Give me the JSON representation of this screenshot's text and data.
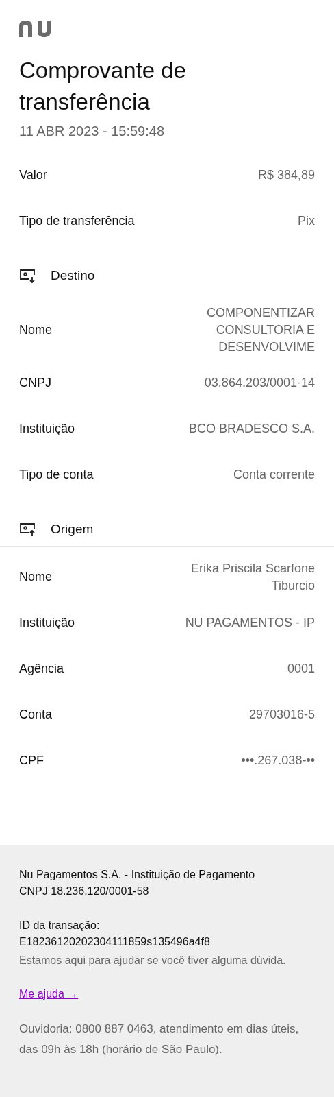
{
  "title": "Comprovante de transferência",
  "datetime": "11 ABR 2023 - 15:59:48",
  "summary": [
    {
      "label": "Valor",
      "value": "R$ 384,89"
    },
    {
      "label": "Tipo de transferência",
      "value": "Pix"
    }
  ],
  "sections": [
    {
      "kind": "destination",
      "title": "Destino",
      "rows": [
        {
          "label": "Nome",
          "value": "COMPONENTIZAR CONSULTORIA E DESENVOLVIME"
        },
        {
          "label": "CNPJ",
          "value": "03.864.203/0001-14"
        },
        {
          "label": "Instituição",
          "value": "BCO BRADESCO S.A."
        },
        {
          "label": "Tipo de conta",
          "value": "Conta corrente"
        }
      ]
    },
    {
      "kind": "origin",
      "title": "Origem",
      "rows": [
        {
          "label": "Nome",
          "value": "Erika Priscila Scarfone Tiburcio"
        },
        {
          "label": "Instituição",
          "value": "NU PAGAMENTOS - IP"
        },
        {
          "label": "Agência",
          "value": "0001"
        },
        {
          "label": "Conta",
          "value": "29703016-5"
        },
        {
          "label": "CPF",
          "value": "•••.267.038-••"
        }
      ]
    }
  ],
  "footer": {
    "company": [
      "Nu Pagamentos S.A. - Instituição de Pagamento",
      "CNPJ 18.236.120/0001-58"
    ],
    "transaction": [
      "ID da transação:",
      "E18236120202304111859s135496a4f8"
    ],
    "help_text": "Estamos aqui para ajudar se você tiver alguma dúvida.",
    "help_link": "Me ajuda →",
    "ombudsman": "Ouvidoria: 0800 887 0463, atendimento em dias úteis, das 09h às 18h (horário de São Paulo)."
  }
}
